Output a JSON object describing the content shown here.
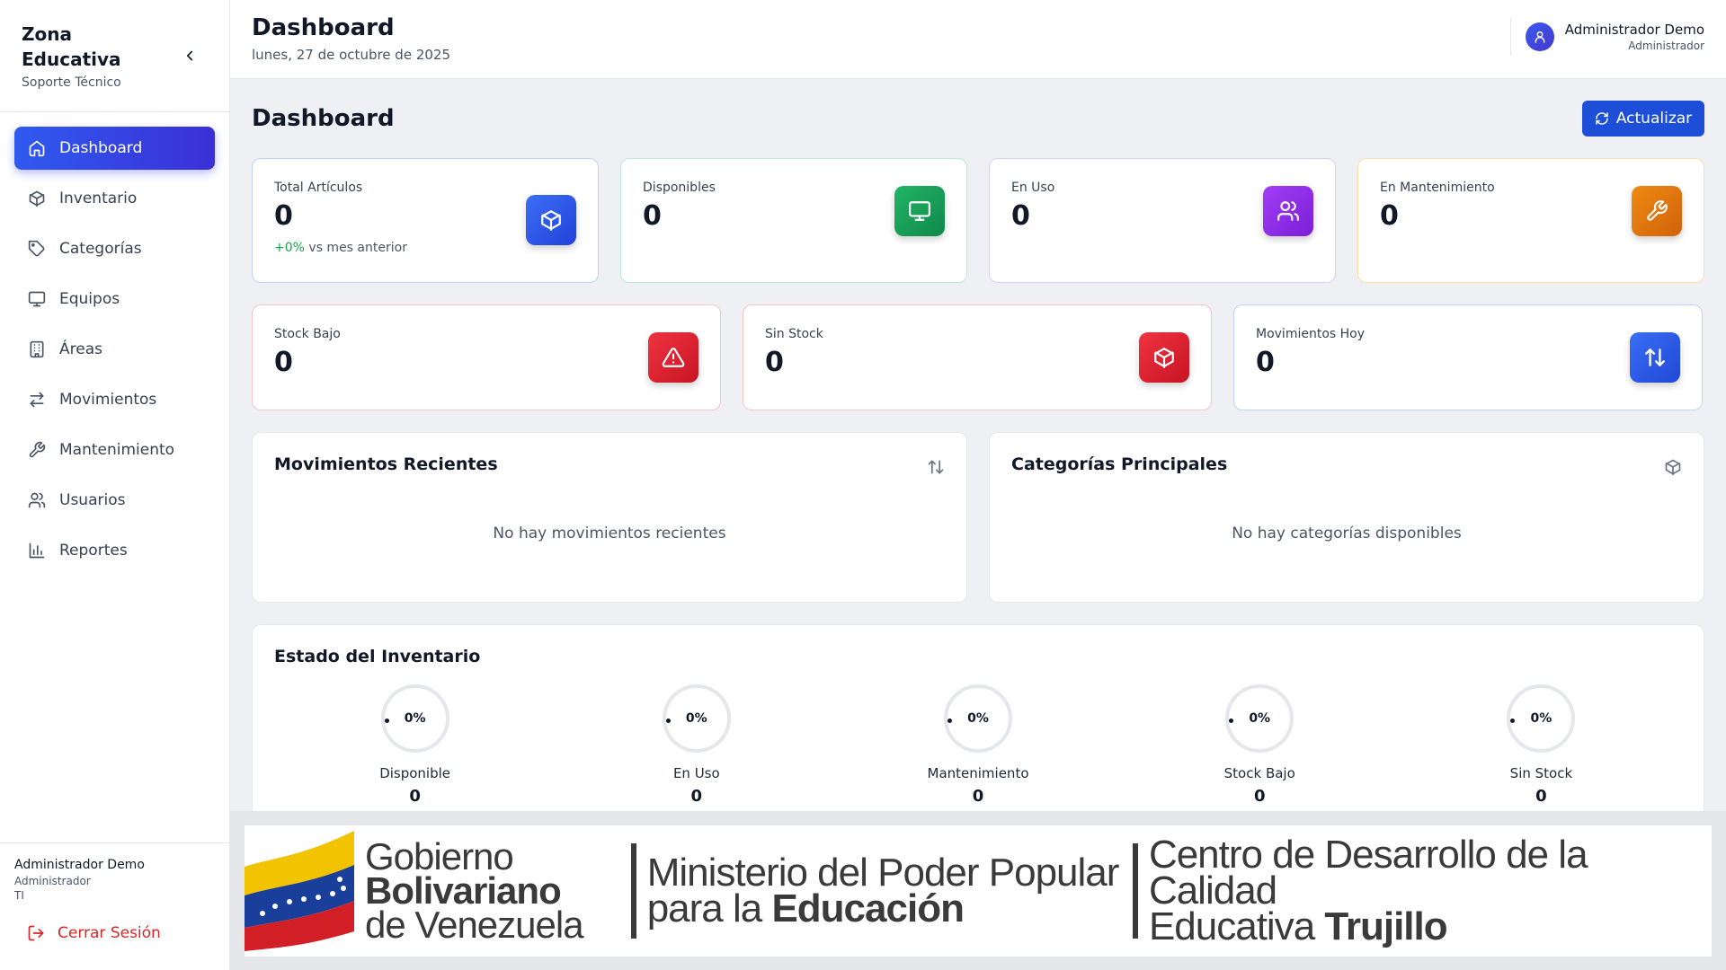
{
  "sidebar": {
    "brand_title": "Zona Educativa",
    "brand_subtitle": "Soporte Técnico",
    "items": [
      {
        "label": "Dashboard",
        "icon": "home-icon",
        "active": true
      },
      {
        "label": "Inventario",
        "icon": "package-icon"
      },
      {
        "label": "Categorías",
        "icon": "tag-icon"
      },
      {
        "label": "Equipos",
        "icon": "monitor-icon"
      },
      {
        "label": "Áreas",
        "icon": "building-icon"
      },
      {
        "label": "Movimientos",
        "icon": "arrows-left-right-icon"
      },
      {
        "label": "Mantenimiento",
        "icon": "wrench-icon"
      },
      {
        "label": "Usuarios",
        "icon": "users-icon"
      },
      {
        "label": "Reportes",
        "icon": "bar-chart-icon"
      }
    ],
    "footer": {
      "user_name": "Administrador Demo",
      "user_role": "Administrador",
      "user_area": "TI",
      "logout_label": "Cerrar Sesión"
    }
  },
  "header": {
    "title": "Dashboard",
    "date": "lunes, 27 de octubre de 2025",
    "user_name": "Administrador Demo",
    "user_role": "Administrador"
  },
  "main": {
    "page_title": "Dashboard",
    "refresh_label": "Actualizar",
    "stats_row1": [
      {
        "label": "Total Artículos",
        "value": "0",
        "delta_value": "+0%",
        "delta_text": " vs mes anterior",
        "icon": "package-icon",
        "color": "#2f5af0"
      },
      {
        "label": "Disponibles",
        "value": "0",
        "icon": "monitor-icon",
        "color": "#16a34a"
      },
      {
        "label": "En Uso",
        "value": "0",
        "icon": "users-icon",
        "color": "#9333ea"
      },
      {
        "label": "En Mantenimiento",
        "value": "0",
        "icon": "wrench-icon",
        "color": "#ea7c0c"
      }
    ],
    "stats_row2": [
      {
        "label": "Stock Bajo",
        "value": "0",
        "icon": "alert-triangle-icon",
        "color": "#dc2626"
      },
      {
        "label": "Sin Stock",
        "value": "0",
        "icon": "package-icon",
        "color": "#dc2626"
      },
      {
        "label": "Movimientos Hoy",
        "value": "0",
        "icon": "arrows-up-down-icon",
        "color": "#2563eb"
      }
    ],
    "recent": {
      "title": "Movimientos Recientes",
      "empty": "No hay movimientos recientes"
    },
    "categories": {
      "title": "Categorías Principales",
      "empty": "No hay categorías disponibles"
    },
    "inventory": {
      "title": "Estado del Inventario",
      "items": [
        {
          "percent": "0%",
          "label": "Disponible",
          "value": "0"
        },
        {
          "percent": "0%",
          "label": "En Uso",
          "value": "0"
        },
        {
          "percent": "0%",
          "label": "Mantenimiento",
          "value": "0"
        },
        {
          "percent": "0%",
          "label": "Stock Bajo",
          "value": "0"
        },
        {
          "percent": "0%",
          "label": "Sin Stock",
          "value": "0"
        }
      ]
    }
  },
  "banner": {
    "b1_line1": "Gobierno",
    "b1_line2": "Bolivariano",
    "b1_line3": "de Venezuela",
    "b2_line1": "Ministerio del Poder Popular",
    "b2_line2a": "para la ",
    "b2_line2b": "Educación",
    "b3_line1": "Centro de Desarrollo de la Calidad",
    "b3_line2a": "Educativa ",
    "b3_line2b": "Trujillo"
  }
}
